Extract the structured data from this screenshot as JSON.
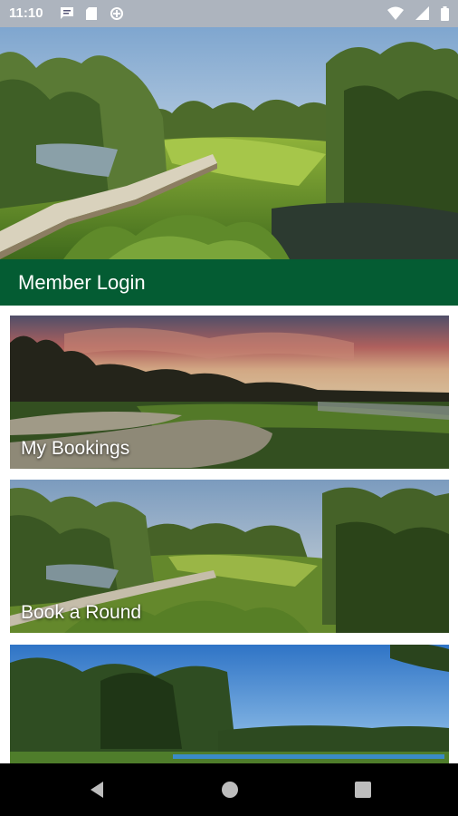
{
  "status_bar": {
    "time": "11:10",
    "left_icons": [
      "message-icon",
      "sd-card-icon",
      "data-saver-icon"
    ],
    "right_icons": [
      "wifi-icon",
      "signal-icon",
      "battery-icon"
    ]
  },
  "hero": {
    "image": "golf-course-boardwalk-photo"
  },
  "login": {
    "label": "Member Login",
    "color": "#045c33"
  },
  "cards": [
    {
      "label": "My Bookings",
      "image": "sunset-golf-green-photo"
    },
    {
      "label": "Book a Round",
      "image": "golf-course-boardwalk-photo"
    },
    {
      "label": "",
      "image": "blue-sky-fairway-photo"
    }
  ],
  "nav_bar": {
    "buttons": [
      "back-icon",
      "home-icon",
      "recents-icon"
    ]
  }
}
